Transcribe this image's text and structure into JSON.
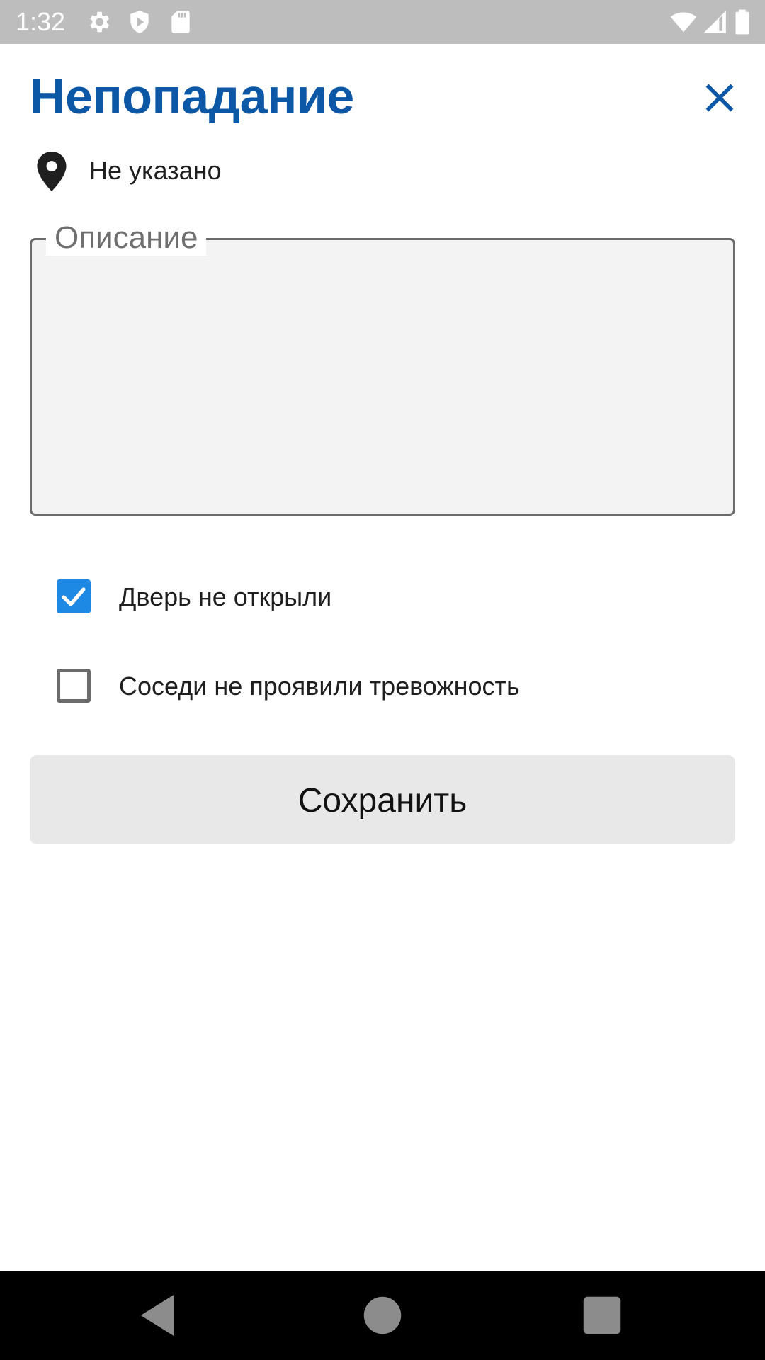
{
  "status_bar": {
    "time": "1:32",
    "icons": [
      "gear-icon",
      "shield-icon",
      "sd-card-icon",
      "wifi-icon",
      "cell-signal-icon",
      "battery-icon"
    ]
  },
  "header": {
    "title": "Непопадание",
    "close_icon": "close-icon"
  },
  "location": {
    "icon": "location-pin-icon",
    "text": "Не указано"
  },
  "description": {
    "label": "Описание",
    "value": ""
  },
  "checkboxes": [
    {
      "label": "Дверь не открыли",
      "checked": true
    },
    {
      "label": "Соседи не проявили тревожность",
      "checked": false
    }
  ],
  "save_button": {
    "label": "Сохранить"
  },
  "nav_bar": {
    "icons": [
      "back-icon",
      "home-icon",
      "recents-icon"
    ]
  },
  "colors": {
    "title": "#0d58a6",
    "accent": "#1e88e5",
    "status_bar": "#bdbdbd",
    "button_bg": "#e8e8e8"
  }
}
